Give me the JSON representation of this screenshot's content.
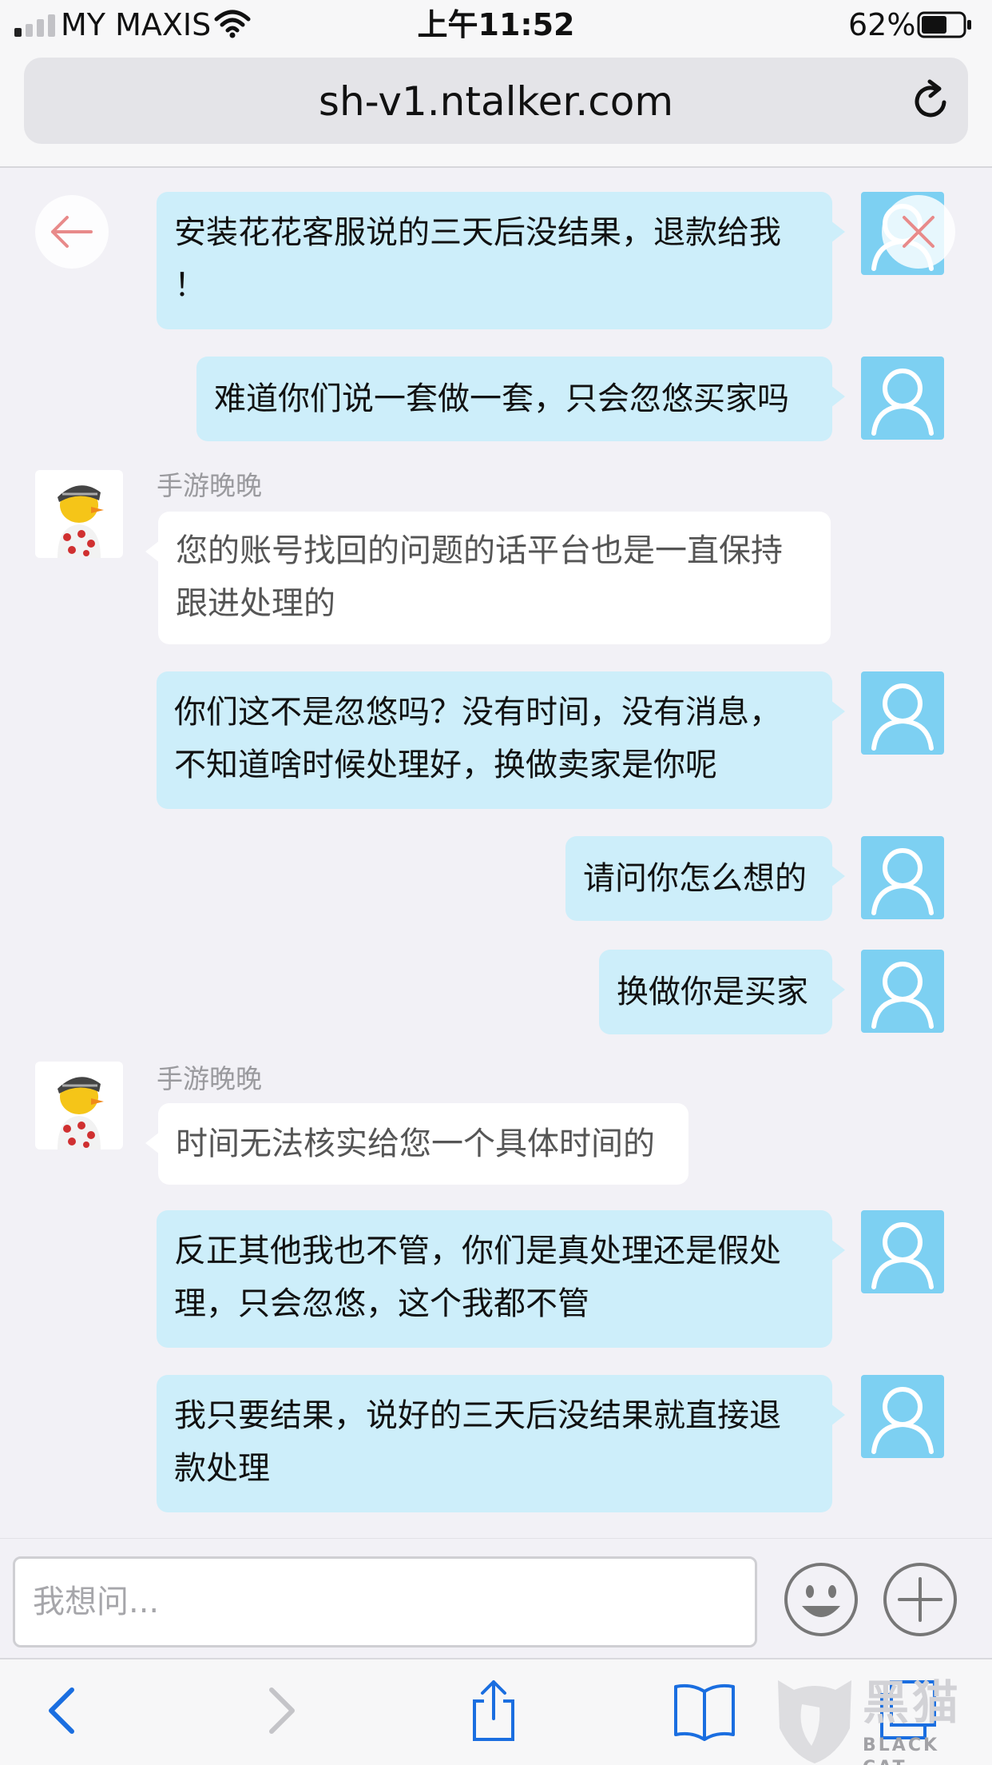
{
  "status_bar": {
    "carrier": "MY MAXIS",
    "time": "上午11:52",
    "battery": "62%",
    "battery_level": 0.62,
    "signal_bars_on": 1,
    "signal_bars_total": 4
  },
  "browser": {
    "url": "sh-v1.ntalker.com"
  },
  "chat": {
    "agent_name": "手游晚晚",
    "messages": [
      {
        "sender": "user",
        "lines": [
          "安装花花客服说的三天后没结果，退款给我",
          "！"
        ]
      },
      {
        "sender": "user",
        "lines": [
          "难道你们说一套做一套，只会忽悠买家吗"
        ]
      },
      {
        "sender": "agent",
        "name": "手游晚晚",
        "lines": [
          "您的账号找回的问题的话平台也是一直保持",
          "跟进处理的"
        ]
      },
      {
        "sender": "user",
        "lines": [
          "你们这不是忽悠吗？没有时间，没有消息，",
          "不知道啥时候处理好，换做卖家是你呢"
        ]
      },
      {
        "sender": "user",
        "lines": [
          "请问你怎么想的"
        ]
      },
      {
        "sender": "user",
        "lines": [
          "换做你是买家"
        ]
      },
      {
        "sender": "agent",
        "name": "手游晚晚",
        "lines": [
          "时间无法核实给您一个具体时间的"
        ]
      },
      {
        "sender": "user",
        "lines": [
          "反正其他我也不管，你们是真处理还是假处",
          "理，只会忽悠，这个我都不管"
        ]
      },
      {
        "sender": "user",
        "lines": [
          "我只要结果，说好的三天后没结果就直接退",
          "款处理"
        ]
      }
    ]
  },
  "composer": {
    "placeholder": "我想问..."
  },
  "icons": {
    "back": "arrow-left-icon",
    "close": "close-x-icon",
    "user_avatar": "person-outline-icon",
    "agent_avatar": "cartoon-avatar-icon",
    "emoji": "smiley-face-icon",
    "add": "plus-circle-icon",
    "reload": "reload-icon",
    "nav_back": "chevron-left-icon",
    "nav_forward": "chevron-right-icon",
    "share": "share-icon",
    "bookmarks": "book-icon",
    "tabs": "tabs-icon"
  },
  "colors": {
    "user_bubble": "#cdeefa",
    "agent_bubble": "#ffffff",
    "user_avatar_bg": "#7dd0f2",
    "ios_blue": "#1a6ee0",
    "nav_accent": "#e88a8a"
  },
  "watermark": {
    "title": "黑猫",
    "subtitle": "BLACK CAT"
  }
}
